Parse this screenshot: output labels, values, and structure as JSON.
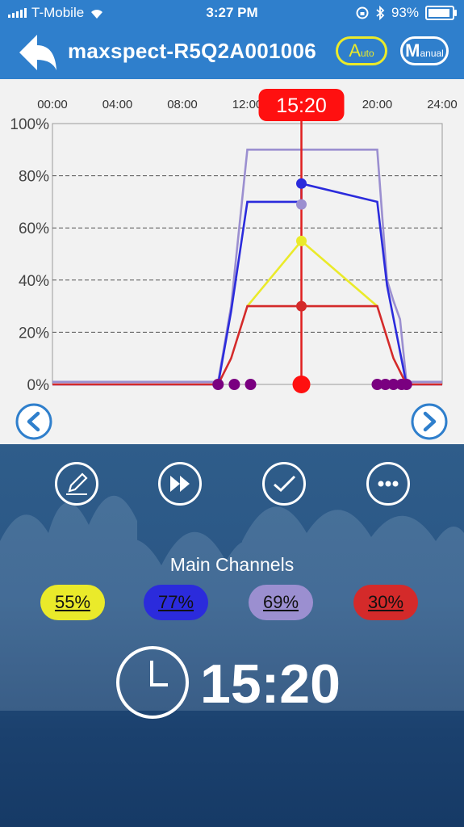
{
  "status_bar": {
    "carrier": "T-Mobile",
    "time": "3:27 PM",
    "battery": "93%",
    "battery_level": 0.93
  },
  "header": {
    "device_name": "maxspect-R5Q2A001006",
    "auto_big": "A",
    "auto_small": "uto",
    "manual_big": "M",
    "manual_small": "anual"
  },
  "chart_data": {
    "type": "line",
    "x_ticks": [
      "00:00",
      "04:00",
      "08:00",
      "12:00",
      "16:00",
      "20:00",
      "24:00"
    ],
    "y_ticks": [
      "0%",
      "20%",
      "40%",
      "60%",
      "80%",
      "100%"
    ],
    "ylim": [
      0,
      100
    ],
    "xlim": [
      0,
      24
    ],
    "grid": true,
    "current_time_label": "15:20",
    "current_time": 15.33,
    "series": [
      {
        "color": "#9b8fd0",
        "points": [
          [
            0,
            1
          ],
          [
            10.2,
            1
          ],
          [
            11,
            30
          ],
          [
            12,
            90
          ],
          [
            15.33,
            90
          ],
          [
            20,
            90
          ],
          [
            20.6,
            40
          ],
          [
            21,
            32
          ],
          [
            21.4,
            25
          ],
          [
            21.8,
            1
          ],
          [
            24,
            1
          ]
        ],
        "current": 69
      },
      {
        "color": "#2b2bdc",
        "points": [
          [
            0,
            0
          ],
          [
            10.2,
            0
          ],
          [
            11,
            28
          ],
          [
            12,
            70
          ],
          [
            15.33,
            70
          ],
          [
            15.33,
            77
          ],
          [
            20,
            70
          ],
          [
            20.6,
            38
          ],
          [
            21.8,
            0
          ],
          [
            24,
            0
          ]
        ],
        "current": 77
      },
      {
        "color": "#eaea2a",
        "points": [
          [
            12,
            30
          ],
          [
            15.33,
            55
          ],
          [
            20,
            30
          ]
        ],
        "current": 55
      },
      {
        "color": "#d42a2a",
        "points": [
          [
            0,
            0
          ],
          [
            10.2,
            0
          ],
          [
            11,
            10
          ],
          [
            12,
            30
          ],
          [
            20,
            30
          ],
          [
            21,
            10
          ],
          [
            21.8,
            0
          ],
          [
            24,
            0
          ]
        ],
        "current": 30
      }
    ],
    "markers_hours": [
      10.2,
      11.2,
      12.2,
      20,
      20.5,
      21,
      21.5,
      21.8
    ],
    "marker_color": "#7a0080"
  },
  "channels": {
    "title": "Main Channels",
    "items": [
      {
        "value": "55%",
        "color": "#eaea2a"
      },
      {
        "value": "77%",
        "color": "#2b2bdc"
      },
      {
        "value": "69%",
        "color": "#9b8fd0"
      },
      {
        "value": "30%",
        "color": "#d42a2a"
      }
    ]
  },
  "clock": {
    "time": "15:20"
  }
}
